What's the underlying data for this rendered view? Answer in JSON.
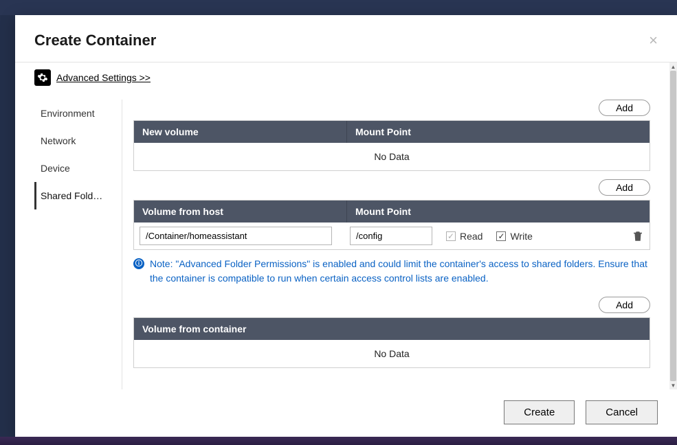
{
  "modal": {
    "title": "Create Container",
    "advanced_link": "Advanced Settings >>"
  },
  "sidenav": {
    "items": [
      {
        "label": "Environment"
      },
      {
        "label": "Network"
      },
      {
        "label": "Device"
      },
      {
        "label": "Shared Fold…"
      }
    ],
    "selected": 3
  },
  "section1": {
    "add_label": "Add",
    "header_col1": "New volume",
    "header_col2": "Mount Point",
    "empty_text": "No Data"
  },
  "section2": {
    "add_label": "Add",
    "header_col1": "Volume from host",
    "header_col2": "Mount Point",
    "row": {
      "host_value": "/Container/homeassistant",
      "mount_value": "/config",
      "read_label": "Read",
      "read_checked": true,
      "read_disabled": true,
      "write_label": "Write",
      "write_checked": true,
      "write_disabled": false
    },
    "note_text": "Note: \"Advanced Folder Permissions\" is enabled and could limit the container's access to shared folders. Ensure that the container is compatible to run when certain access control lists are enabled."
  },
  "section3": {
    "add_label": "Add",
    "header_col1": "Volume from container",
    "empty_text": "No Data"
  },
  "footer": {
    "create_label": "Create",
    "cancel_label": "Cancel"
  }
}
